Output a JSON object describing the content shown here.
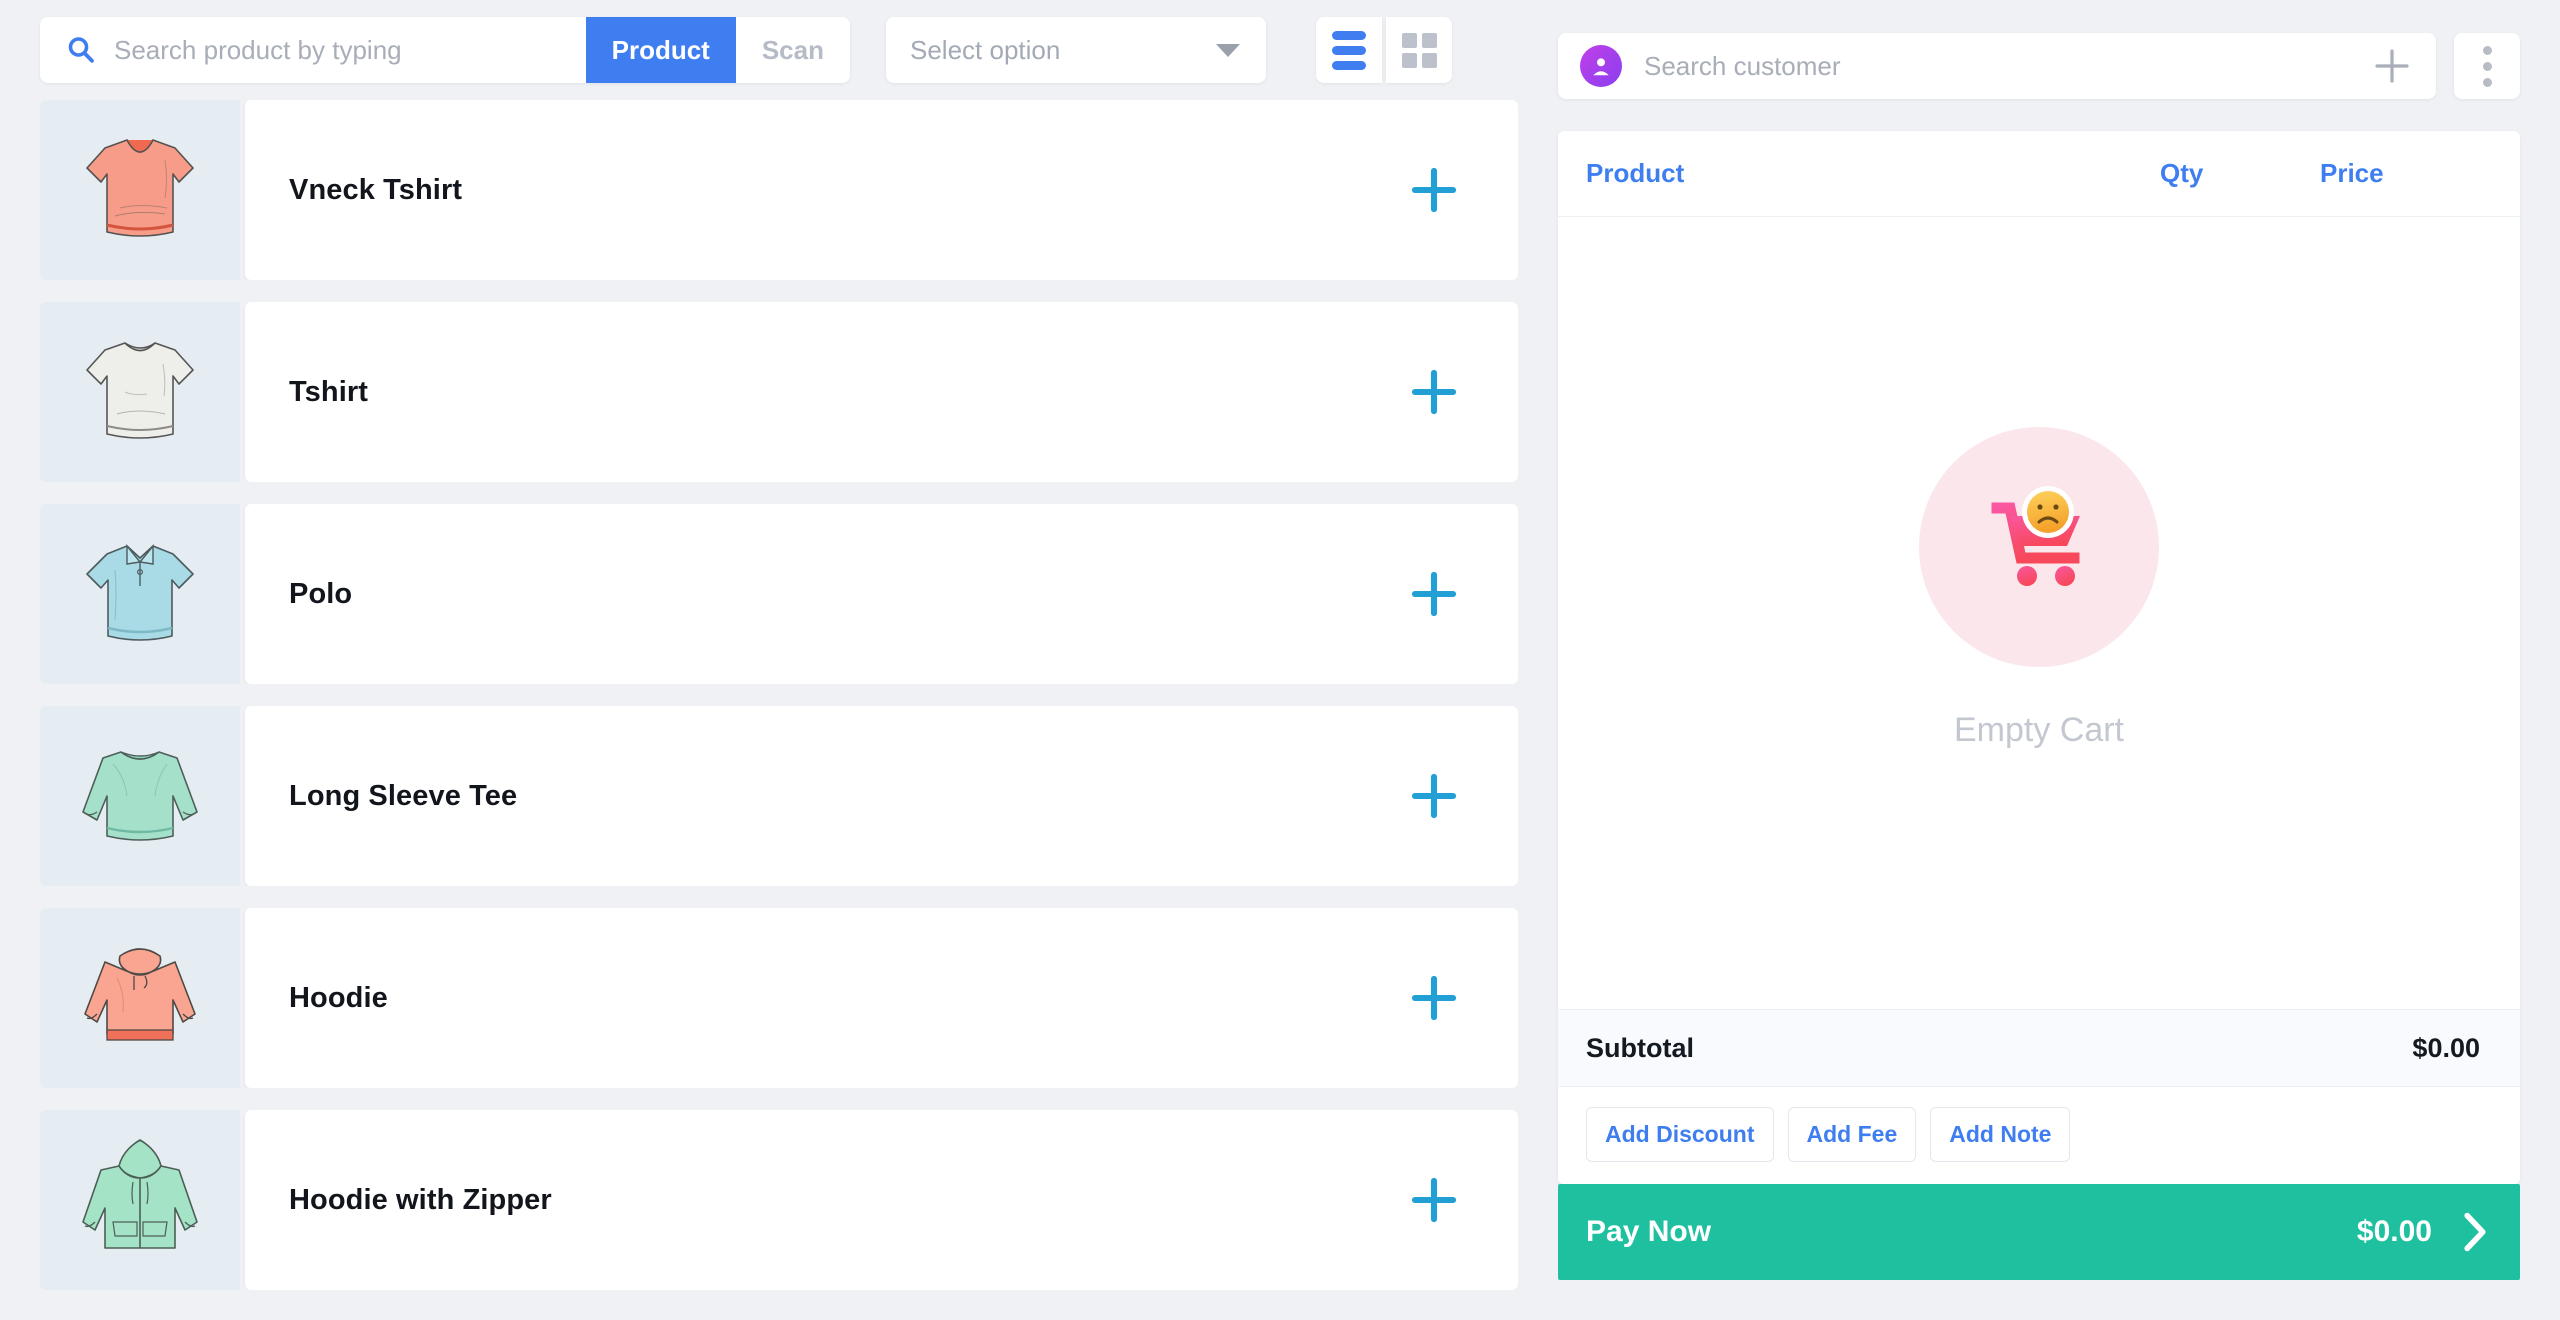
{
  "toolbar": {
    "search_icon": "search-icon",
    "search_placeholder": "Search product by typing",
    "search_value": "",
    "tab_product": "Product",
    "tab_scan": "Scan",
    "active_tab": "Product",
    "select_label": "Select option",
    "caret_icon": "chevron-down-icon",
    "view_list_icon": "list-view-icon",
    "view_grid_icon": "grid-view-icon",
    "active_view": "list",
    "accent_blue": "#3f7ef0"
  },
  "customer": {
    "avatar_icon": "user-avatar-icon",
    "placeholder": "Search customer",
    "value": "",
    "add_icon": "plus-icon",
    "kebab_icon": "more-vertical-icon"
  },
  "products": [
    {
      "name": "Vneck Tshirt",
      "thumb": "vneck-tshirt-thumb",
      "color": "#f79c88",
      "add_icon": "plus-icon"
    },
    {
      "name": "Tshirt",
      "thumb": "tshirt-thumb",
      "color": "#ebebe8",
      "add_icon": "plus-icon"
    },
    {
      "name": "Polo",
      "thumb": "polo-thumb",
      "color": "#a8dbe6",
      "add_icon": "plus-icon"
    },
    {
      "name": "Long Sleeve Tee",
      "thumb": "long-sleeve-tee-thumb",
      "color": "#a5e0cb",
      "add_icon": "plus-icon"
    },
    {
      "name": "Hoodie",
      "thumb": "hoodie-thumb",
      "color": "#f9a591",
      "add_icon": "plus-icon"
    },
    {
      "name": "Hoodie with Zipper",
      "thumb": "hoodie-with-zipper-thumb",
      "color": "#a5e3c7",
      "add_icon": "plus-icon"
    }
  ],
  "cart": {
    "header": {
      "product": "Product",
      "qty": "Qty",
      "price": "Price"
    },
    "items": [],
    "empty_label": "Empty Cart",
    "empty_icon": "empty-cart-icon",
    "subtotal_label": "Subtotal",
    "subtotal_value": "$0.00",
    "actions": {
      "add_discount": "Add Discount",
      "add_fee": "Add Fee",
      "add_note": "Add Note"
    },
    "pay_label": "Pay Now",
    "pay_amount": "$0.00",
    "pay_chevron_icon": "chevron-right-icon",
    "pay_color": "#1fc0a0"
  }
}
